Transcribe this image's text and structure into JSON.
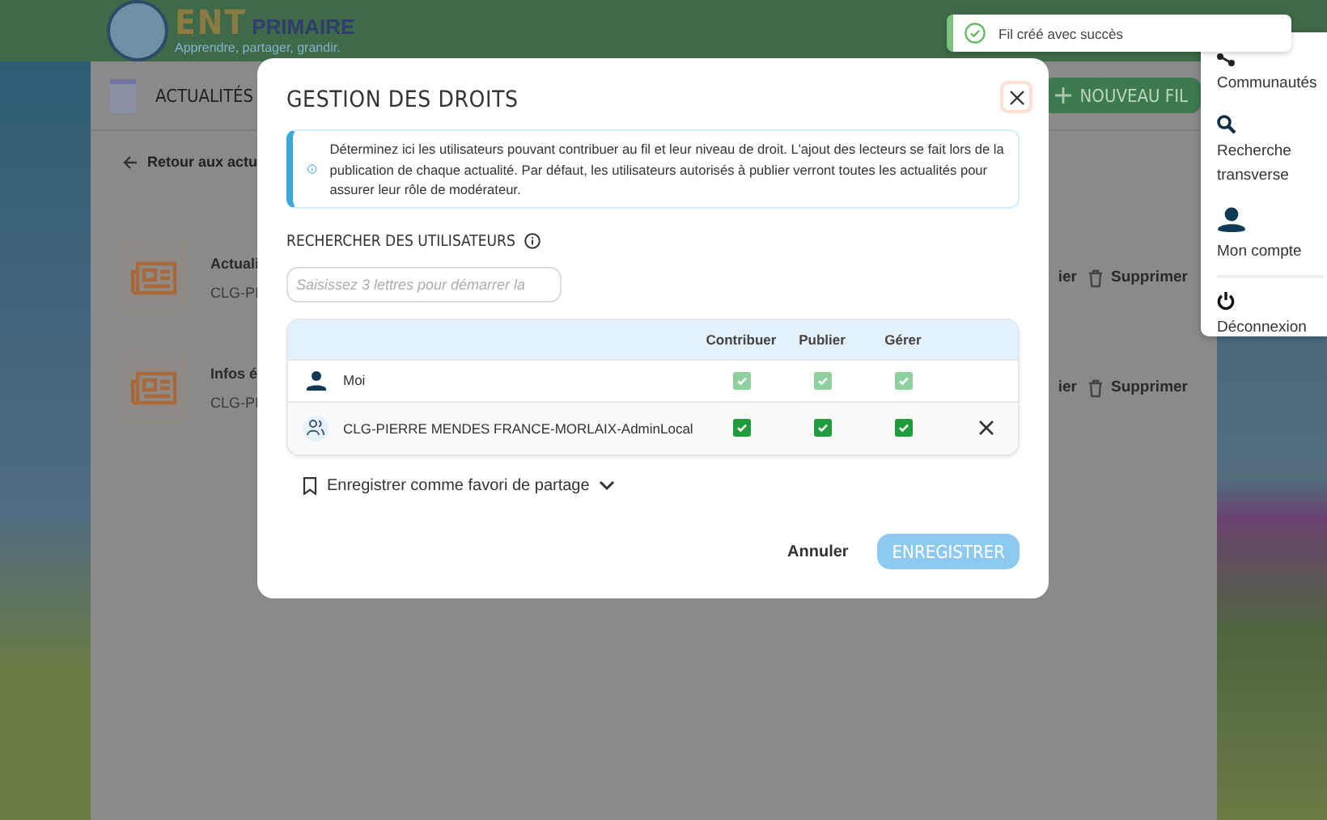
{
  "header": {
    "logo_word": "ENT",
    "logo_word_2": "PRIMAIRE",
    "tagline": "Apprendre, partager, grandir."
  },
  "page": {
    "app_title": "ACTUALITÉS",
    "new_button": "NOUVEAU FIL",
    "back_link": "Retour aux actu",
    "feeds": [
      {
        "title": "Actuali",
        "subtitle": "CLG-PI",
        "edit_action": "ier",
        "delete_action": "Supprimer"
      },
      {
        "title": "Infos é",
        "subtitle": "CLG-PI",
        "edit_action": "ier",
        "delete_action": "Supprimer"
      }
    ]
  },
  "modal": {
    "title": "GESTION DES DROITS",
    "info": "Déterminez ici les utilisateurs pouvant contribuer au fil et leur niveau de droit. L'ajout des lecteurs se fait lors de la publication de chaque actualité. Par défaut, les utilisateurs autorisés à publier verront toutes les actualités pour assurer leur rôle de modérateur.",
    "search_label": "RECHERCHER DES UTILISATEURS",
    "search": {
      "placeholder": "Saisissez 3 lettres pour démarrer la"
    },
    "table": {
      "columns": [
        "Contribuer",
        "Publier",
        "Gérer"
      ],
      "rows": [
        {
          "kind": "user",
          "name": "Moi",
          "removable": false,
          "rights": [
            {
              "checked": true,
              "disabled": true
            },
            {
              "checked": true,
              "disabled": true
            },
            {
              "checked": true,
              "disabled": true
            }
          ]
        },
        {
          "kind": "group",
          "name": "CLG-PIERRE MENDES FRANCE-MORLAIX-AdminLocal",
          "removable": true,
          "rights": [
            {
              "checked": true,
              "disabled": false
            },
            {
              "checked": true,
              "disabled": false
            },
            {
              "checked": true,
              "disabled": false
            }
          ]
        }
      ]
    },
    "favorite": "Enregistrer comme favori de partage",
    "cancel": "Annuler",
    "save": {
      "label": "ENREGISTRER",
      "disabled": true
    }
  },
  "toast": {
    "message": "Fil créé avec succès"
  },
  "menu": {
    "items": [
      {
        "kind": "community",
        "label": "Communautés"
      },
      {
        "kind": "search",
        "label": "Recherche transverse"
      },
      {
        "kind": "account",
        "label": "Mon compte"
      },
      {
        "kind": "logout",
        "label": "Déconnexion"
      }
    ]
  }
}
